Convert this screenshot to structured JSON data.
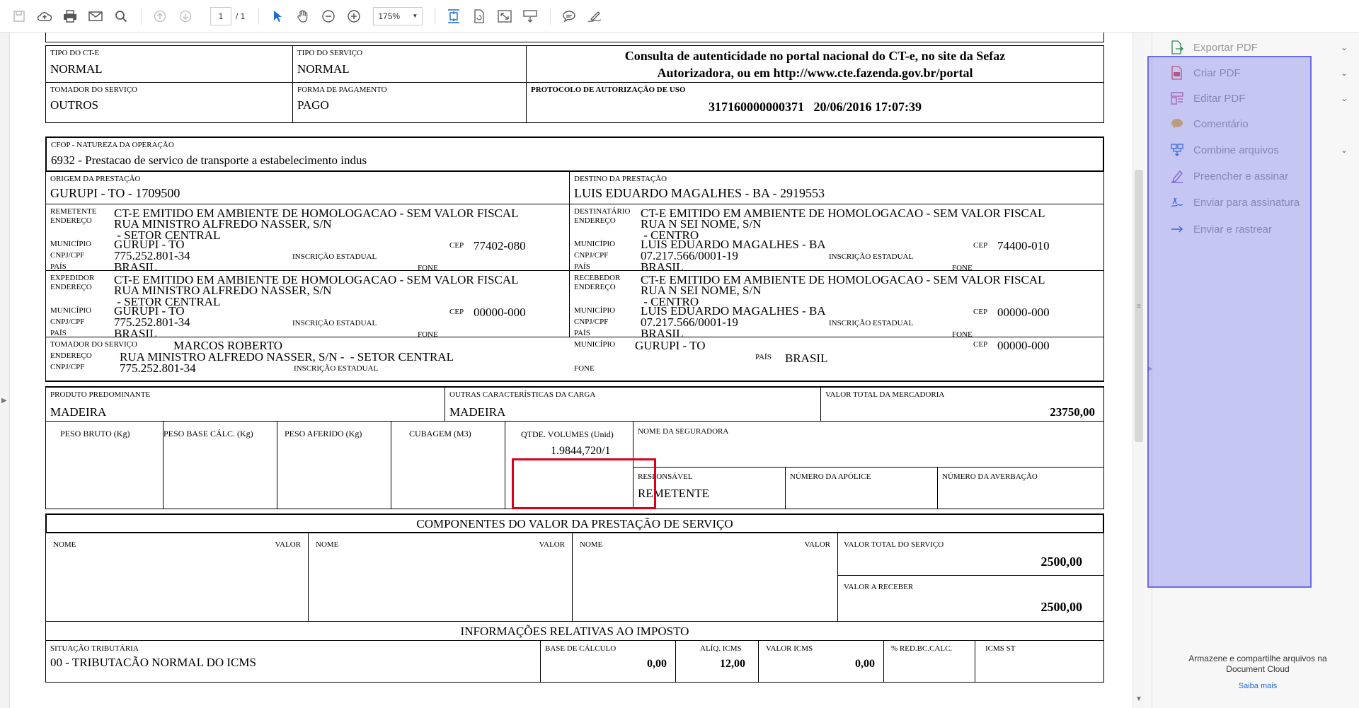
{
  "toolbar": {
    "page_current": "1",
    "page_total": "/ 1",
    "zoom": "175%"
  },
  "doc": {
    "tipo_cte_label": "TIPO DO CT-E",
    "tipo_cte": "NORMAL",
    "tipo_servico_label": "TIPO DO SERVIÇO",
    "tipo_servico": "NORMAL",
    "consulta_line1": "Consulta de autenticidade no portal nacional do CT-e, no site da Sefaz",
    "consulta_line2": "Autorizadora, ou em http://www.cte.fazenda.gov.br/portal",
    "tomador_label": "TOMADOR DO SERVIÇO",
    "tomador": "OUTROS",
    "forma_pag_label": "FORMA DE PAGAMENTO",
    "forma_pag": "PAGO",
    "protocolo_label": "PROTOCOLO DE AUTORIZAÇÃO DE USO",
    "protocolo": "317160000000371   20/06/2016 17:07:39",
    "cfop_label": "CFOP - NATUREZA DA OPERAÇÃO",
    "cfop": "6932 - Prestacao de servico de transporte a estabelecimento indus",
    "origem_label": "ORIGEM DA PRESTAÇÃO",
    "origem": "GURUPI - TO - 1709500",
    "destino_label": "DESTINO DA PRESTAÇÃO",
    "destino": "LUIS EDUARDO MAGALHES - BA - 2919553",
    "l_remetente": "REMETENTE",
    "l_destinatario": "DESTINATÁRIO",
    "l_expedidor": "EXPEDIDOR",
    "l_recebedor": "RECEBEDOR",
    "l_tomador": "TOMADOR DO SERVIÇO",
    "l_endereco": "ENDEREÇO",
    "l_municipio": "MUNICÍPIO",
    "l_cnpj": "CNPJ/CPF",
    "l_pais": "PAÍS",
    "l_cep": "CEP",
    "l_ie": "INSCRIÇÃO ESTADUAL",
    "l_fone": "FONE",
    "homolog": "CT-E EMITIDO EM AMBIENTE DE HOMOLOGACAO - SEM VALOR FISCAL",
    "rem": {
      "endereco": "RUA MINISTRO ALFREDO NASSER, S/N",
      "bairro": " - SETOR CENTRAL",
      "municipio": "GURUPI - TO",
      "cnpj": "775.252.801-34",
      "pais": "BRASIL",
      "cep": "77402-080"
    },
    "dest": {
      "endereco": "RUA N SEI NOME, S/N",
      "bairro": " - CENTRO",
      "municipio": "LUIS EDUARDO MAGALHES - BA",
      "cnpj": "07.217.566/0001-19",
      "pais": "BRASIL",
      "cep": "74400-010"
    },
    "exp": {
      "endereco": "RUA MINISTRO ALFREDO NASSER, S/N",
      "bairro": " - SETOR CENTRAL",
      "municipio": "GURUPI - TO",
      "cnpj": "775.252.801-34",
      "pais": "BRASIL",
      "cep": "00000-000"
    },
    "rec": {
      "endereco": "RUA N SEI NOME, S/N",
      "bairro": " - CENTRO",
      "municipio": "LUIS EDUARDO MAGALHES - BA",
      "cnpj": "07.217.566/0001-19",
      "pais": "BRASIL",
      "cep": "00000-000"
    },
    "tom": {
      "nome": "MARCOS ROBERTO",
      "endereco": "RUA MINISTRO ALFREDO NASSER, S/N -  - SETOR CENTRAL",
      "cnpj": "775.252.801-34",
      "municipio": "GURUPI - TO",
      "pais": "BRASIL",
      "cep": "00000-000"
    },
    "produto_label": "PRODUTO PREDOMINANTE",
    "produto": "MADEIRA",
    "outras_label": "OUTRAS CARACTERÍSTICAS DA CARGA",
    "outras": "MADEIRA",
    "valor_merc_label": "VALOR TOTAL DA MERCADORIA",
    "valor_merc": "23750,00",
    "peso_bruto_label": "PESO BRUTO (Kg)",
    "peso_base_label": "PESO BASE CÁLC. (Kg)",
    "peso_aferido_label": "PESO AFERIDO (Kg)",
    "cubagem_label": "CUBAGEM (M3)",
    "qtde_label": "QTDE. VOLUMES (Unid)",
    "qtde": "1.9844,720/1",
    "seguradora_label": "NOME DA SEGURADORA",
    "responsavel_label": "RESPONSÁVEL",
    "responsavel": "REMETENTE",
    "apolice_label": "NÚMERO DA APÓLICE",
    "averbacao_label": "NÚMERO DA AVERBAÇÃO",
    "componentes_title": "COMPONENTES DO VALOR DA PRESTAÇÃO DE SERVIÇO",
    "nome_label": "NOME",
    "valor_label": "VALOR",
    "valor_total_servico_label": "VALOR TOTAL DO SERVIÇO",
    "valor_total_servico": "2500,00",
    "valor_receber_label": "VALOR A RECEBER",
    "valor_receber": "2500,00",
    "imposto_title": "INFORMAÇÕES RELATIVAS AO IMPOSTO",
    "situacao_label": "SITUAÇÃO TRIBUTÁRIA",
    "situacao": "00 - TRIBUTACÃO NORMAL DO ICMS",
    "base_calc_label": "BASE DE CÁLCULO",
    "base_calc": "0,00",
    "aliq_label": "ALÍQ. ICMS",
    "aliq": "12,00",
    "valor_icms_label": "VALOR ICMS",
    "valor_icms": "0,00",
    "red_label": "% RED.BC.CALC.",
    "icms_st_label": "ICMS ST"
  },
  "panel": {
    "items": [
      {
        "label": "Exportar PDF",
        "icon": "export-pdf-icon",
        "color": "#2e8b57",
        "chev": "⌄"
      },
      {
        "label": "Criar PDF",
        "icon": "create-pdf-icon",
        "color": "#d9534f",
        "chev": "⌄"
      },
      {
        "label": "Editar PDF",
        "icon": "edit-pdf-icon",
        "color": "#c06090",
        "chev": "⌄"
      },
      {
        "label": "Comentário",
        "icon": "comment-icon",
        "color": "#e8b84a",
        "chev": ""
      },
      {
        "label": "Combine arquivos",
        "icon": "combine-files-icon",
        "color": "#2a6ad6",
        "chev": "⌄"
      },
      {
        "label": "Preencher e assinar",
        "icon": "fill-sign-icon",
        "color": "#8a5bd6",
        "chev": ""
      },
      {
        "label": "Enviar para assinatura",
        "icon": "send-signature-icon",
        "color": "#2a6ad6",
        "chev": ""
      },
      {
        "label": "Enviar e rastrear",
        "icon": "send-track-icon",
        "color": "#2a6ad6",
        "chev": ""
      }
    ],
    "promo": "Armazene e compartilhe arquivos na Document Cloud",
    "promo_link": "Saiba mais"
  }
}
